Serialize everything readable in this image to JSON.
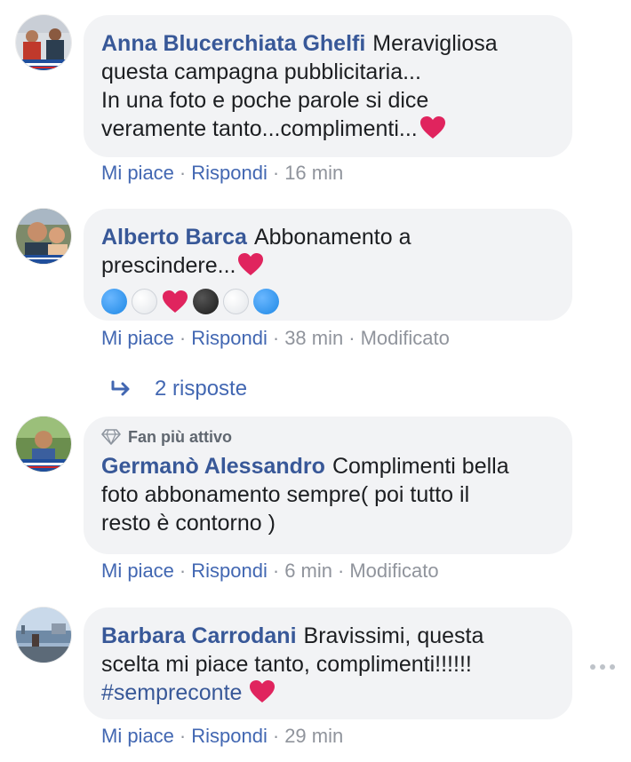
{
  "comments": [
    {
      "author": "Anna Blucerchiata Ghelfi",
      "lines": [
        "Meravigliosa",
        "questa campagna pubblicitaria...",
        "In una foto e poche parole si dice",
        "veramente tanto...complimenti..."
      ],
      "actions": {
        "like": "Mi piace",
        "reply": "Rispondi",
        "time": "16 min"
      }
    },
    {
      "author": "Alberto Barca",
      "lines": [
        "Abbonamento a",
        "prescindere..."
      ],
      "emoji_row": [
        "blue-circle",
        "white-circle",
        "heart",
        "black-circle",
        "white-circle",
        "blue-circle"
      ],
      "actions": {
        "like": "Mi piace",
        "reply": "Rispondi",
        "time": "38 min",
        "edited": "Modificato"
      },
      "replies": "2 risposte"
    },
    {
      "badge": "Fan più attivo",
      "author": "Germanò Alessandro",
      "lines": [
        "Complimenti bella",
        "foto abbonamento sempre( poi tutto il",
        "resto è contorno )"
      ],
      "actions": {
        "like": "Mi piace",
        "reply": "Rispondi",
        "time": "6 min",
        "edited": "Modificato"
      }
    },
    {
      "author": "Barbara Carrodani",
      "lines": [
        "Bravissimi, questa",
        "scelta mi piace tanto, complimenti!!!!!!",
        "#sempreconte"
      ],
      "actions": {
        "like": "Mi piace",
        "reply": "Rispondi",
        "time": "29 min"
      }
    }
  ],
  "colors": {
    "link": "#385898",
    "action": "#4267b2",
    "meta": "#90949c",
    "bubble": "#f2f3f5",
    "heart": "#e0245e"
  },
  "icons": {
    "heart": "heart-icon",
    "reply_arrow": "reply-arrow-icon",
    "diamond": "diamond-icon",
    "more": "more-options-icon"
  }
}
